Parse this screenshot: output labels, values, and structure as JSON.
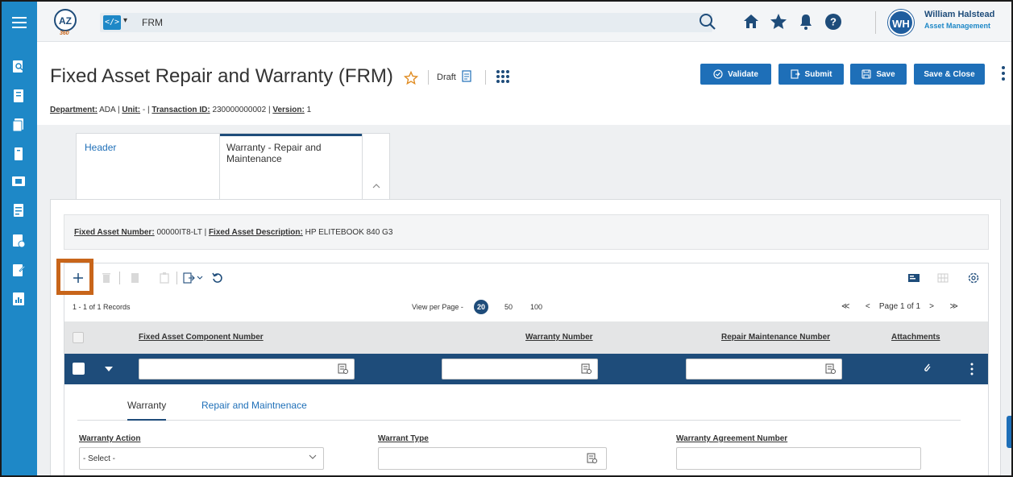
{
  "app": {
    "search_value": "FRM",
    "code_chip": "</>"
  },
  "user": {
    "initials": "WH",
    "name": "William Halstead",
    "department": "Asset Management"
  },
  "page": {
    "title": "Fixed Asset Repair and Warranty (FRM)",
    "status": "Draft",
    "meta": {
      "department_label": "Department:",
      "department_value": "ADA",
      "unit_label": "Unit:",
      "unit_value": "-",
      "transaction_label": "Transaction ID:",
      "transaction_value": "230000000002",
      "version_label": "Version:",
      "version_value": "1"
    }
  },
  "actions": {
    "validate": "Validate",
    "submit": "Submit",
    "save": "Save",
    "save_close": "Save & Close"
  },
  "section_tabs": {
    "header": "Header",
    "warranty": "Warranty - Repair and Maintenance"
  },
  "asset_info": {
    "number_label": "Fixed Asset Number:",
    "number_value": "00000IT8-LT",
    "description_label": "Fixed Asset Description:",
    "description_value": "HP ELITEBOOK 840 G3"
  },
  "grid": {
    "records": "1 - 1 of 1 Records",
    "view_per_page": "View per Page -",
    "page_sizes": [
      "20",
      "50",
      "100"
    ],
    "pager": {
      "first": "≪",
      "prev": "<",
      "page": "Page 1 of 1",
      "next": ">",
      "last": "≫"
    },
    "columns": {
      "component": "Fixed Asset Component Number",
      "warranty": "Warranty Number",
      "repair": "Repair Maintenance Number",
      "attachments": "Attachments"
    }
  },
  "detail_tabs": {
    "warranty": "Warranty",
    "repair": "Repair and Maintnenace"
  },
  "fields": {
    "warranty_action_label": "Warranty Action",
    "warranty_action_value": "- Select -",
    "warrant_type_label": "Warrant Type",
    "agreement_label": "Warranty Agreement Number"
  },
  "colors": {
    "rail": "#1e88c7",
    "primary": "#1e6fb8",
    "row": "#1e4c7a",
    "highlight": "#c8651a"
  }
}
